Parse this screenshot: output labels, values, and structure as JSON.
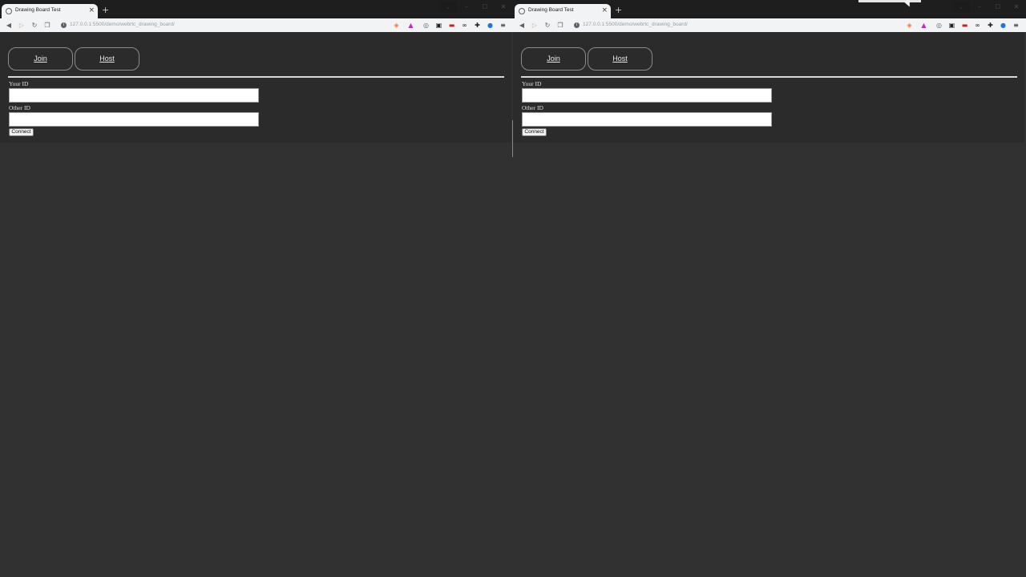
{
  "windows": [
    {
      "tab_title": "Drawing Board Test",
      "tab_close": "×",
      "new_tab": "+",
      "window_controls": {
        "menu": "⌄",
        "minimize": "–",
        "maximize": "☐",
        "close": "✕"
      },
      "nav": {
        "back": "◀",
        "forward": "▷",
        "reload": "↻",
        "bookmark": "❐"
      },
      "url": "127.0.0.1:5500/demo/webrtc_drawing_board/",
      "extensions": {
        "brave": "◈",
        "rewards": "▲",
        "camera": "◎",
        "box1": "▣",
        "box2": "▬",
        "glasses": "∞",
        "puzzle": "✚",
        "globe": "●",
        "menu": "≡"
      },
      "page": {
        "join_label": "Join",
        "host_label": "Host",
        "your_id_label": "Your ID",
        "your_id_value": "",
        "other_id_label": "Other ID",
        "other_id_value": "",
        "connect_label": "Connect"
      }
    },
    {
      "tab_title": "Drawing Board Test",
      "tab_close": "×",
      "new_tab": "+",
      "window_controls": {
        "menu": "⌄",
        "minimize": "–",
        "maximize": "☐",
        "close": "✕"
      },
      "nav": {
        "back": "◀",
        "forward": "▷",
        "reload": "↻",
        "bookmark": "❐"
      },
      "url": "127.0.0.1:5500/demo/webrtc_drawing_board/",
      "extensions": {
        "brave": "◈",
        "rewards": "▲",
        "camera": "◎",
        "box1": "▣",
        "box2": "▬",
        "glasses": "∞",
        "puzzle": "✚",
        "globe": "●",
        "menu": "≡"
      },
      "page": {
        "join_label": "Join",
        "host_label": "Host",
        "your_id_label": "Your ID",
        "your_id_value": "",
        "other_id_label": "Other ID",
        "other_id_value": "",
        "connect_label": "Connect"
      }
    }
  ],
  "colors": {
    "background": "#313131",
    "panel": "#2b2b2b",
    "tabstrip": "#1e1e1e",
    "toolbar": "#f1f3f4",
    "button_border": "#8a8a8a",
    "rule": "#d8d8d8"
  }
}
